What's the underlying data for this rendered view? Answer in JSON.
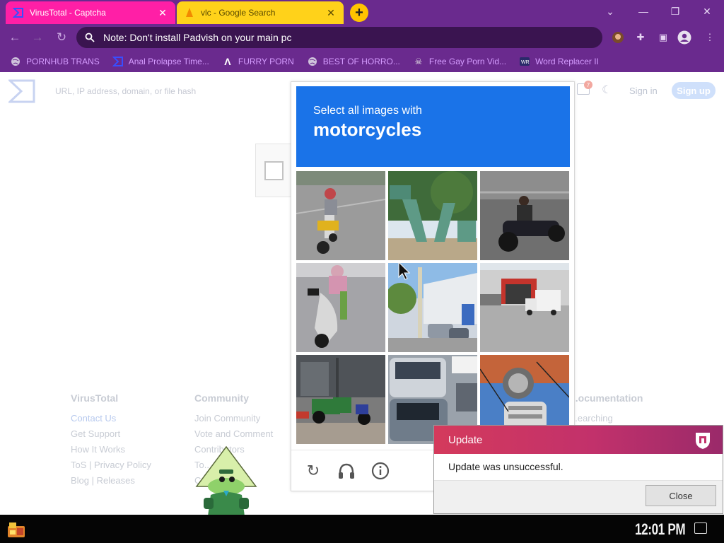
{
  "browser": {
    "tabs": [
      {
        "title": "VirusTotal - Captcha",
        "active": true
      },
      {
        "title": "vlc - Google Search",
        "active": false
      }
    ],
    "omnibox": "Note: Don't install Padvish on your main pc",
    "bookmarks": [
      {
        "label": "PORNHUB TRANS",
        "icon": "globe-icon"
      },
      {
        "label": "Anal Prolapse Time...",
        "icon": "virustotal-icon"
      },
      {
        "label": "FURRY PORN",
        "icon": "lambda-icon"
      },
      {
        "label": "BEST OF HORRO...",
        "icon": "globe-icon"
      },
      {
        "label": "Free Gay Porn Vid...",
        "icon": "skull-icon"
      },
      {
        "label": "Word Replacer II",
        "icon": "wr-icon"
      }
    ]
  },
  "virustotal": {
    "search_placeholder": "URL, IP address, domain, or file hash",
    "notification_count": "7",
    "sign_in": "Sign in",
    "sign_up": "Sign up",
    "footer": {
      "col1": {
        "title": "VirusTotal",
        "links": [
          "Contact Us",
          "Get Support",
          "How It Works",
          "ToS | Privacy Policy",
          "Blog | Releases"
        ]
      },
      "col2": {
        "title": "Community",
        "links": [
          "Join Community",
          "Vote and Comment",
          "Contributors",
          "To...",
          "C...ozz"
        ]
      },
      "col3": {
        "title": "...ocumentation",
        "links": [
          "...earching"
        ]
      }
    }
  },
  "captcha": {
    "instruction": "Select all images with",
    "target": "motorcycles",
    "tiles": [
      "motorcycle-rider-road",
      "green-sculpture-trees",
      "motorcycle-rider-street",
      "scooter-rider-road",
      "street-buildings-cars",
      "truck-warehouse",
      "scooter-sidewalk",
      "parked-cars",
      "motorcycle-engine-closeup"
    ]
  },
  "dialog": {
    "title": "Update",
    "message": "Update was unsuccessful.",
    "close_label": "Close"
  },
  "taskbar": {
    "clock": "12:01 PM"
  },
  "colors": {
    "chrome": "#6a2a8e",
    "tab_active": "#ff1fa6",
    "tab_inactive": "#ffd21a",
    "bookmark_text": "#d59cff",
    "captcha_blue": "#1a73e8",
    "dialog_accent": "#d43a5c"
  }
}
